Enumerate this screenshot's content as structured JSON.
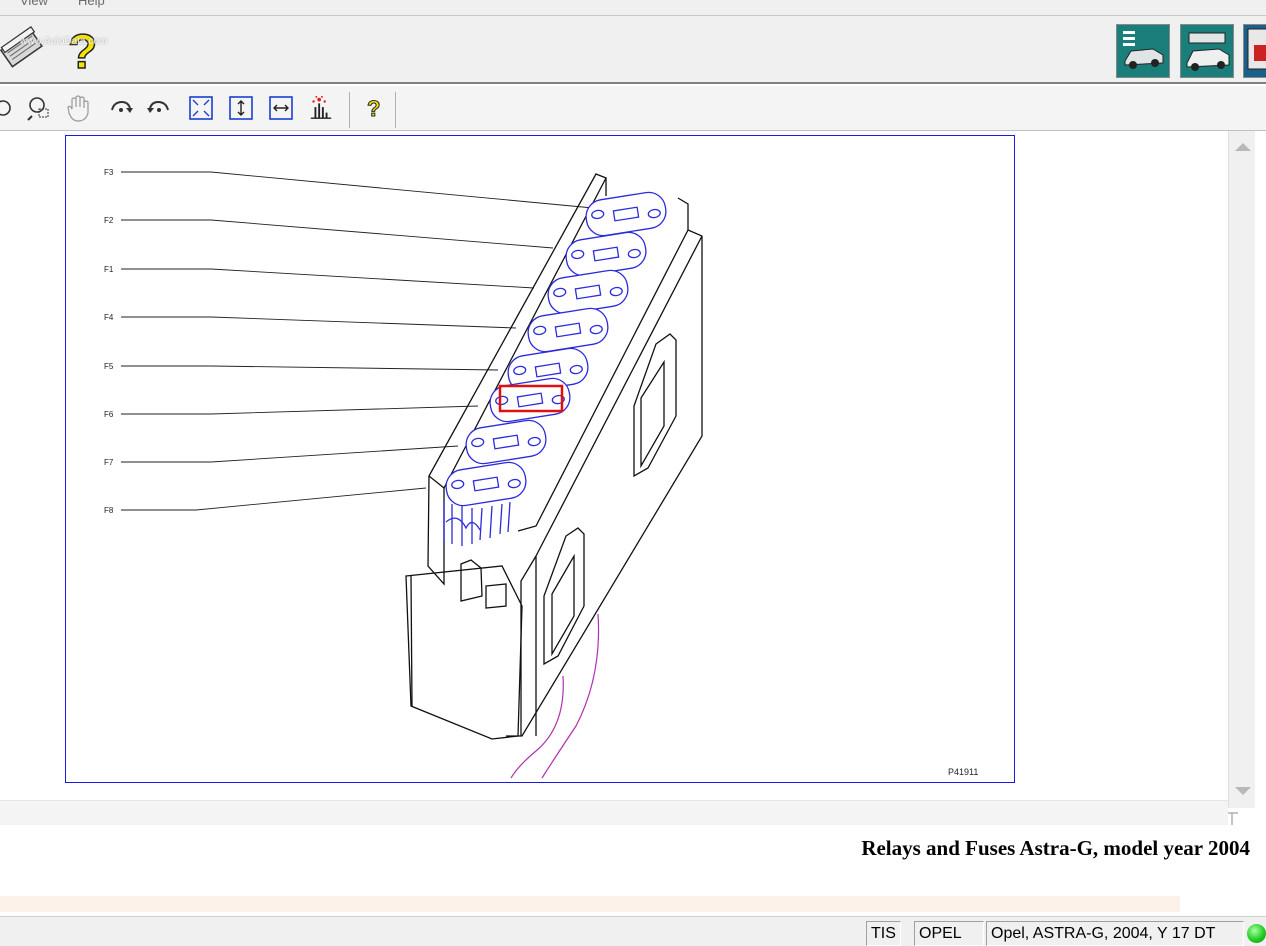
{
  "menu": {
    "view": "View",
    "help": "Help"
  },
  "watermark": "www.AutoData.com",
  "toolbar_top": {
    "icons": [
      "book-icon",
      "help-question-icon"
    ],
    "right_icons": [
      "car-list-icon",
      "car-service-icon",
      "car-red-icon"
    ]
  },
  "toolbar_view": {
    "icons": [
      "zoom-circle-icon",
      "zoom-window-icon",
      "pan-hand-icon",
      "rotate-right-icon",
      "rotate-left-icon",
      "fit-all-icon",
      "fit-height-icon",
      "fit-width-icon",
      "highlight-icon",
      "help-icon"
    ]
  },
  "diagram": {
    "labels": [
      "F3",
      "F2",
      "F1",
      "F4",
      "F5",
      "F6",
      "F7",
      "F8"
    ],
    "figure_id": "P41911",
    "highlighted": "F6",
    "colors": {
      "frame": "#1a1ae6",
      "fuse": "#2b2bdc",
      "highlight": "#e01010",
      "wire": "#b030b0"
    }
  },
  "page_title": "Relays and Fuses Astra-G, model year 2004",
  "status": {
    "system": "TIS",
    "brand": "OPEL",
    "vehicle": "Opel, ASTRA-G, 2004, Y 17 DT",
    "indicator_color": "#22cc22"
  }
}
